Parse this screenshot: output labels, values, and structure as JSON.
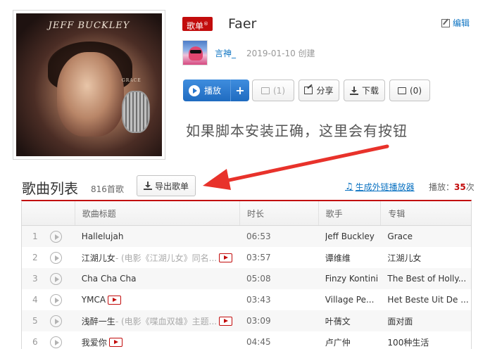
{
  "cover": {
    "artist_text": "JEFF BUCKLEY",
    "album_text": "GRACE"
  },
  "playlist": {
    "tag": "歌单",
    "tag_mark": "®",
    "title": "Faer",
    "edit_label": "编辑",
    "creator": "言神_",
    "created": "2019-01-10 创建"
  },
  "actions": {
    "play": "播放",
    "add": "+",
    "collect": "(1)",
    "share": "分享",
    "download": "下载",
    "comment": "(0)"
  },
  "annotation": "如果脚本安装正确，这里会有按钮",
  "list": {
    "title": "歌曲列表",
    "count": "816首歌",
    "export": "导出歌单",
    "outlink": "生成外链播放器",
    "playcount_label": "播放：",
    "playcount_value": "35",
    "playcount_unit": "次",
    "columns": [
      "",
      "歌曲标题",
      "时长",
      "歌手",
      "专辑"
    ],
    "rows": [
      {
        "idx": "1",
        "title": "Hallelujah",
        "alias": "",
        "mv": false,
        "duration": "06:53",
        "artist": "Jeff Buckley",
        "album": "Grace"
      },
      {
        "idx": "2",
        "title": "江湖儿女",
        "alias": " - (电影《江湖儿女》同名...",
        "mv": true,
        "duration": "03:57",
        "artist": "谭维维",
        "album": "江湖儿女"
      },
      {
        "idx": "3",
        "title": "Cha Cha Cha",
        "alias": "",
        "mv": false,
        "duration": "05:08",
        "artist": "Finzy Kontini",
        "album": "The Best of Holly..."
      },
      {
        "idx": "4",
        "title": "YMCA",
        "alias": "",
        "mv": true,
        "duration": "03:43",
        "artist": "Village Pe...",
        "album": "Het Beste Uit De ..."
      },
      {
        "idx": "5",
        "title": "浅醉一生",
        "alias": " - (电影《喋血双雄》主题...",
        "mv": true,
        "duration": "03:09",
        "artist": "叶蒨文",
        "album": "面对面"
      },
      {
        "idx": "6",
        "title": "我爱你",
        "alias": "",
        "mv": true,
        "duration": "04:45",
        "artist": "卢广仲",
        "album": "100种生活"
      }
    ]
  },
  "colors": {
    "accent": "#c20c0c",
    "link": "#0c73c2",
    "annotation_arrow": "#e8322b"
  }
}
